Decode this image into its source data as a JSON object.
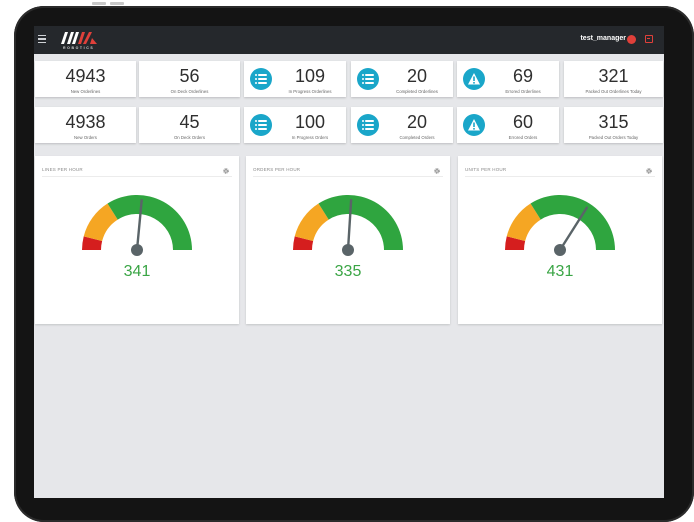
{
  "app": {
    "logo_text": "ROBOTICS",
    "username": "test_manager"
  },
  "icons": {
    "menu": "hamburger-icon",
    "user": "user-circle-icon",
    "logout": "logout-icon",
    "list": "list-icon",
    "warning": "warning-icon",
    "settings": "gear-icon"
  },
  "colors": {
    "topbar": "#25282c",
    "accent_circle": "#1aa6c9",
    "gauge_green": "#2fa53f",
    "gauge_orange": "#f5a623",
    "gauge_red": "#d51e1e",
    "gauge_needle": "#5a6468",
    "value_green": "#3aa545",
    "danger": "#e0403a"
  },
  "row1": [
    {
      "value": "4943",
      "label": "New Orderlines",
      "icon": null
    },
    {
      "value": "56",
      "label": "On Deck Orderlines",
      "icon": null
    },
    {
      "value": "109",
      "label": "In Progress Orderlines",
      "icon": "list-icon"
    },
    {
      "value": "20",
      "label": "Completed Orderlines",
      "icon": "list-icon"
    },
    {
      "value": "69",
      "label": "Errored Orderlines",
      "icon": "warning-icon"
    },
    {
      "value": "321",
      "label": "Packed Out Orderlines Today",
      "icon": null
    }
  ],
  "row2": [
    {
      "value": "4938",
      "label": "New Orders",
      "icon": null
    },
    {
      "value": "45",
      "label": "On Deck Orders",
      "icon": null
    },
    {
      "value": "100",
      "label": "In Progress Orders",
      "icon": "list-icon"
    },
    {
      "value": "20",
      "label": "Completed Orders",
      "icon": "list-icon"
    },
    {
      "value": "60",
      "label": "Errored Orders",
      "icon": "warning-icon"
    },
    {
      "value": "315",
      "label": "Packed Out Orders Today",
      "icon": null
    }
  ],
  "panels": [
    {
      "title": "LINES PER HOUR",
      "value": "341",
      "needle_fraction": 0.53
    },
    {
      "title": "ORDERS PER HOUR",
      "value": "335",
      "needle_fraction": 0.52
    },
    {
      "title": "UNITS PER HOUR",
      "value": "431",
      "needle_fraction": 0.68
    }
  ]
}
